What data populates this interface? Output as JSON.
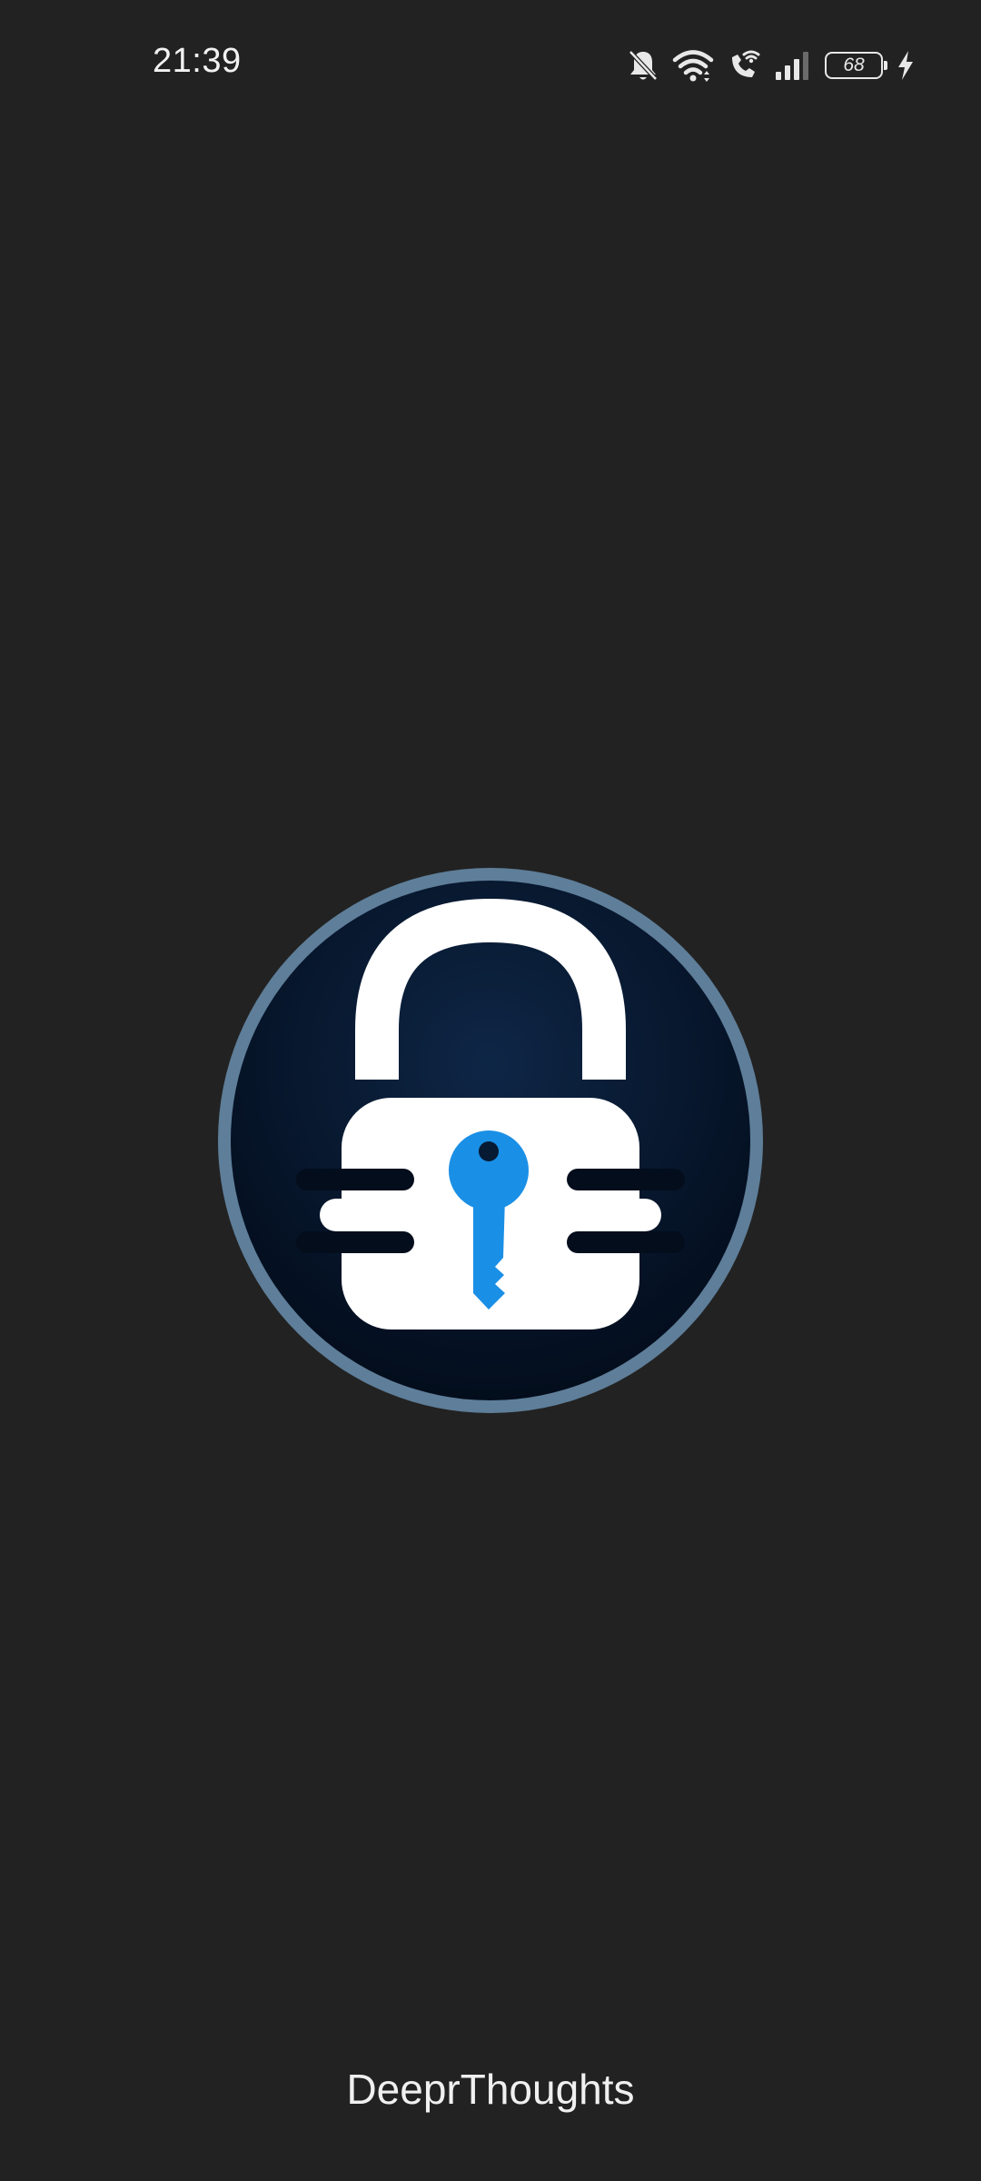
{
  "status_bar": {
    "time": "21:39",
    "battery_level": "68",
    "icons": [
      "bell-muted-icon",
      "wifi-icon",
      "wifi-calling-icon",
      "signal-icon",
      "battery-icon",
      "charging-bolt-icon"
    ]
  },
  "splash": {
    "logo_icon": "padlock-key-icon",
    "app_name": "DeeprThoughts",
    "colors": {
      "background": "#222222",
      "logo_ring": "#5e7e99",
      "logo_fill": "#071a33",
      "key_accent": "#1a8fe6"
    }
  }
}
